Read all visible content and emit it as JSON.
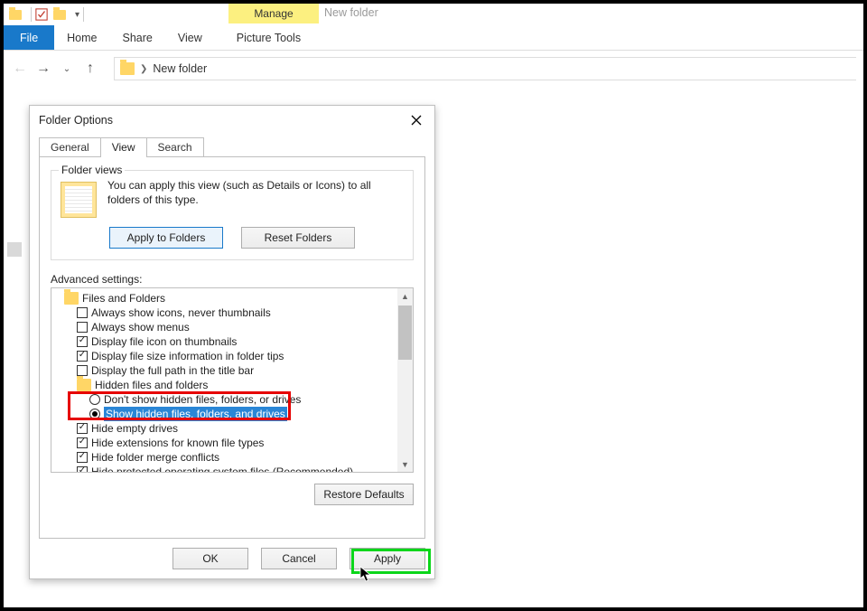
{
  "ribbon": {
    "manage": "Manage",
    "ctx_label": "New folder",
    "file": "File",
    "home": "Home",
    "share": "Share",
    "view": "View",
    "tools": "Picture Tools"
  },
  "address": {
    "location": "New folder"
  },
  "dialog": {
    "title": "Folder Options",
    "tabs": {
      "general": "General",
      "view": "View",
      "search": "Search"
    },
    "fv": {
      "legend": "Folder views",
      "text": "You can apply this view (such as Details or Icons) to all folders of this type.",
      "apply": "Apply to Folders",
      "reset": "Reset Folders"
    },
    "adv_label": "Advanced settings:",
    "tree": {
      "root": "Files and Folders",
      "i1": "Always show icons, never thumbnails",
      "i2": "Always show menus",
      "i3": "Display file icon on thumbnails",
      "i4": "Display file size information in folder tips",
      "i5": "Display the full path in the title bar",
      "hff": "Hidden files and folders",
      "r1": "Don't show hidden files, folders, or drives",
      "r2": "Show hidden files, folders, and drives",
      "i6": "Hide empty drives",
      "i7": "Hide extensions for known file types",
      "i8": "Hide folder merge conflicts",
      "i9": "Hide protected operating system files (Recommended)"
    },
    "restore": "Restore Defaults",
    "ok": "OK",
    "cancel": "Cancel",
    "apply": "Apply"
  }
}
